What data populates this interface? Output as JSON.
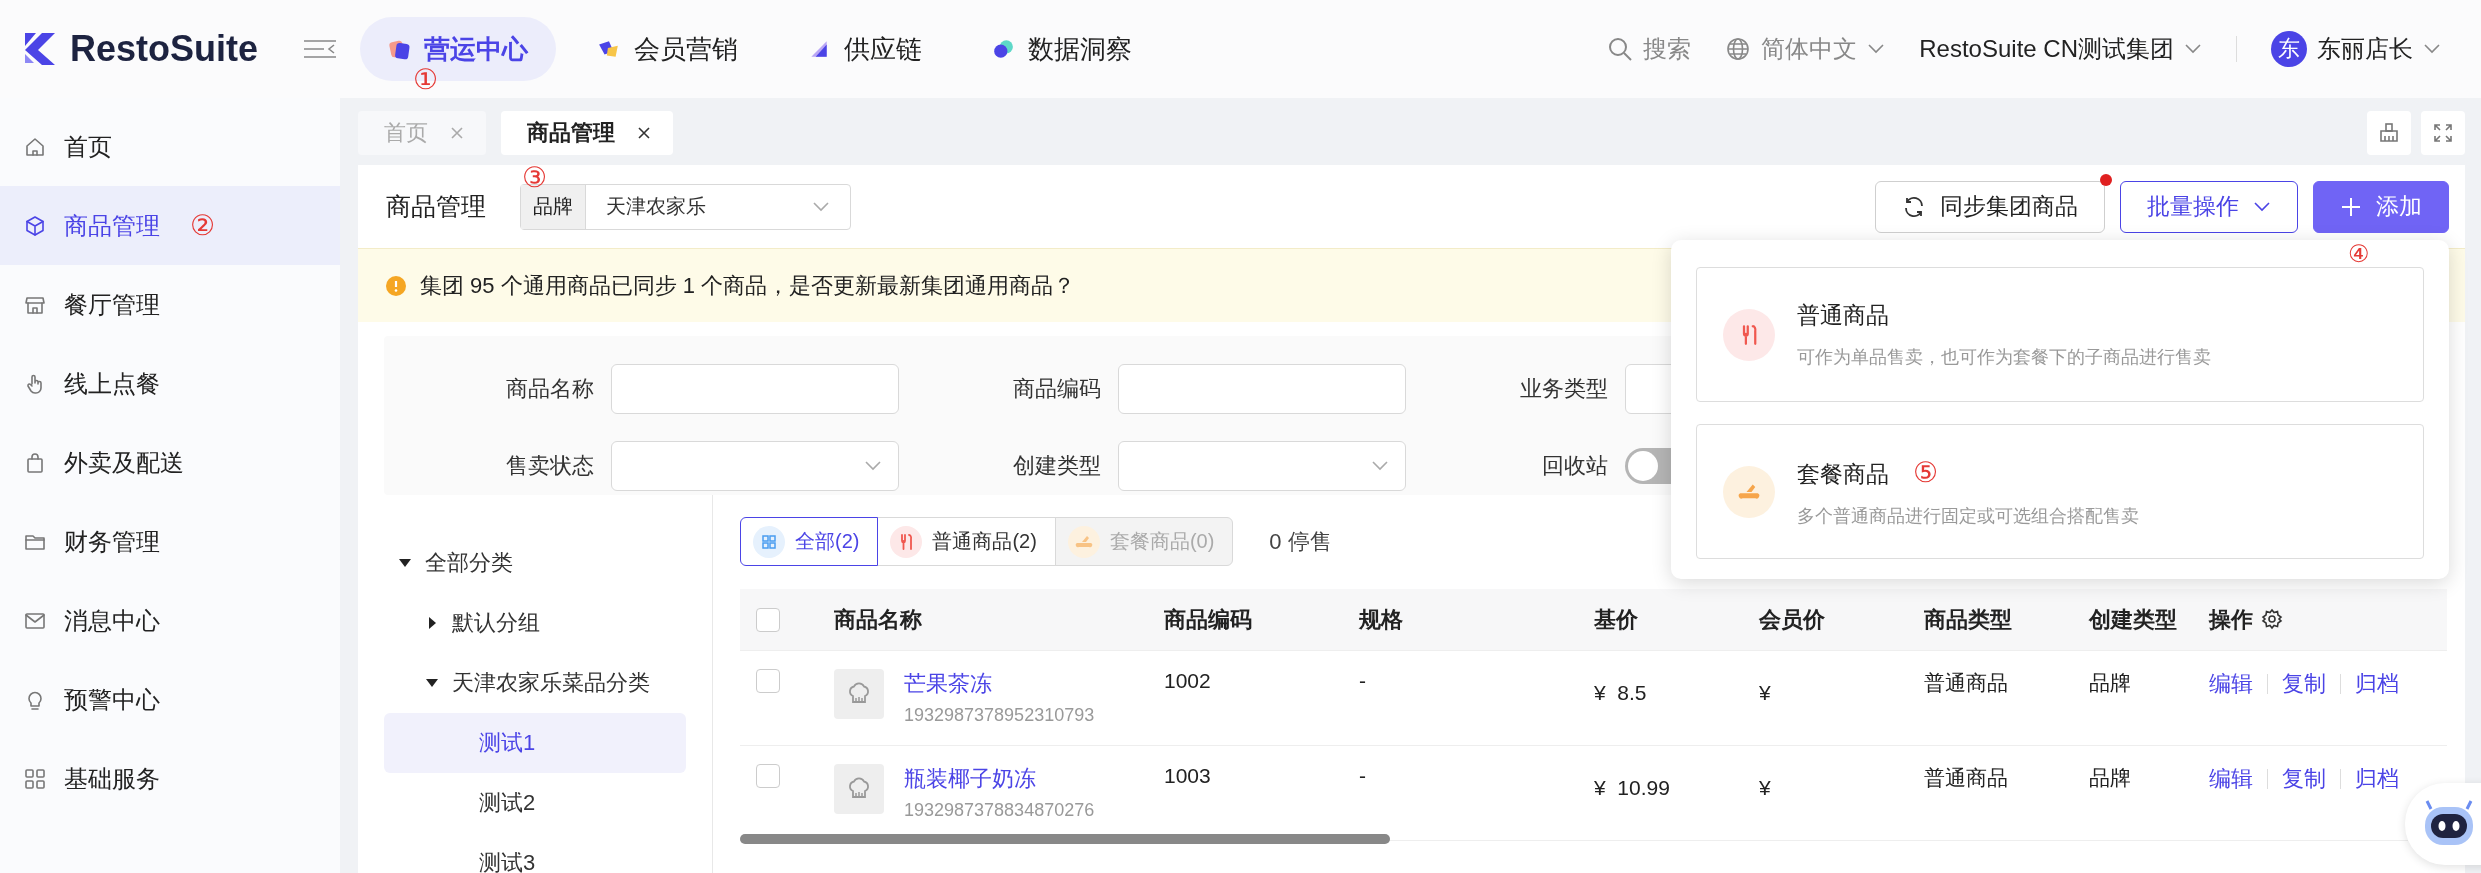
{
  "app": {
    "logo": "RestoSuite"
  },
  "top_nav": [
    {
      "label": "营运中心",
      "selected": true,
      "annotation": "①"
    },
    {
      "label": "会员营销",
      "selected": false
    },
    {
      "label": "供应链",
      "selected": false
    },
    {
      "label": "数据洞察",
      "selected": false
    }
  ],
  "header_right": {
    "search": "搜索",
    "language": "简体中文",
    "organization": "RestoSuite CN测试集团",
    "avatar": "东",
    "user": "东丽店长"
  },
  "sidebar": {
    "items": [
      {
        "label": "首页",
        "selected": false
      },
      {
        "label": "商品管理",
        "selected": true,
        "annotation": "②"
      },
      {
        "label": "餐厅管理",
        "selected": false
      },
      {
        "label": "线上点餐",
        "selected": false
      },
      {
        "label": "外卖及配送",
        "selected": false
      },
      {
        "label": "财务管理",
        "selected": false
      },
      {
        "label": "消息中心",
        "selected": false
      },
      {
        "label": "预警中心",
        "selected": false
      },
      {
        "label": "基础服务",
        "selected": false
      }
    ]
  },
  "page_tabs": [
    {
      "label": "首页",
      "selected": false
    },
    {
      "label": "商品管理",
      "selected": true
    }
  ],
  "page": {
    "title": "商品管理",
    "brand_filter": {
      "label": "品牌",
      "value": "天津农家乐",
      "annotation": "③"
    },
    "sync_button": {
      "label": "同步集团商品",
      "has_notification": true
    },
    "batch_button": {
      "label": "批量操作"
    },
    "add_button": {
      "label": "添加",
      "annotation": "④"
    },
    "alert": "集团 95 个通用商品已同步 1 个商品，是否更新最新集团通用商品？",
    "filters": [
      {
        "label": "商品名称",
        "kind": "text"
      },
      {
        "label": "商品编码",
        "kind": "text"
      },
      {
        "label": "业务类型",
        "kind": "text"
      },
      {
        "label": "售卖状态",
        "kind": "select"
      },
      {
        "label": "创建类型",
        "kind": "select"
      },
      {
        "label": "回收站",
        "kind": "switch",
        "on": false
      }
    ],
    "category_tree": [
      {
        "label": "全部分类",
        "expanded": true,
        "selected": false,
        "children": [
          {
            "label": "默认分组",
            "expanded": false,
            "selected": false
          },
          {
            "label": "天津农家乐菜品分类",
            "expanded": true,
            "selected": false,
            "children": [
              {
                "label": "测试1",
                "selected": true
              },
              {
                "label": "测试2",
                "selected": false
              },
              {
                "label": "测试3",
                "selected": false
              }
            ]
          }
        ]
      }
    ],
    "type_tabs": [
      {
        "label": "全部(2)",
        "kind": "all",
        "selected": true,
        "disabled": false
      },
      {
        "label": "普通商品(2)",
        "kind": "single",
        "selected": false,
        "disabled": false
      },
      {
        "label": "套餐商品(0)",
        "kind": "combo",
        "selected": false,
        "disabled": true
      }
    ],
    "stopped_count": "0 停售",
    "table": {
      "header_checked": false,
      "columns": [
        "商品名称",
        "商品编码",
        "规格",
        "基价",
        "会员价",
        "商品类型",
        "创建类型",
        "操作"
      ],
      "rows": [
        {
          "checked": false,
          "name": "芒果茶冻",
          "id": "1932987378952310793",
          "code": "1002",
          "spec": "-",
          "base_price": "¥  8.5",
          "member_price": "¥",
          "type": "普通商品",
          "create_type": "品牌",
          "actions": [
            "编辑",
            "复制",
            "归档"
          ]
        },
        {
          "checked": false,
          "name": "瓶装椰子奶冻",
          "id": "1932987378834870276",
          "code": "1003",
          "spec": "-",
          "base_price": "¥  10.99",
          "member_price": "¥",
          "type": "普通商品",
          "create_type": "品牌",
          "actions": [
            "编辑",
            "复制",
            "归档"
          ]
        }
      ]
    },
    "add_menu": [
      {
        "kind": "single",
        "title": "普通商品",
        "description": "可作为单品售卖，也可作为套餐下的子商品进行售卖"
      },
      {
        "kind": "combo",
        "title": "套餐商品",
        "description": "多个普通商品进行固定或可选组合搭配售卖",
        "annotation": "⑤"
      }
    ]
  }
}
